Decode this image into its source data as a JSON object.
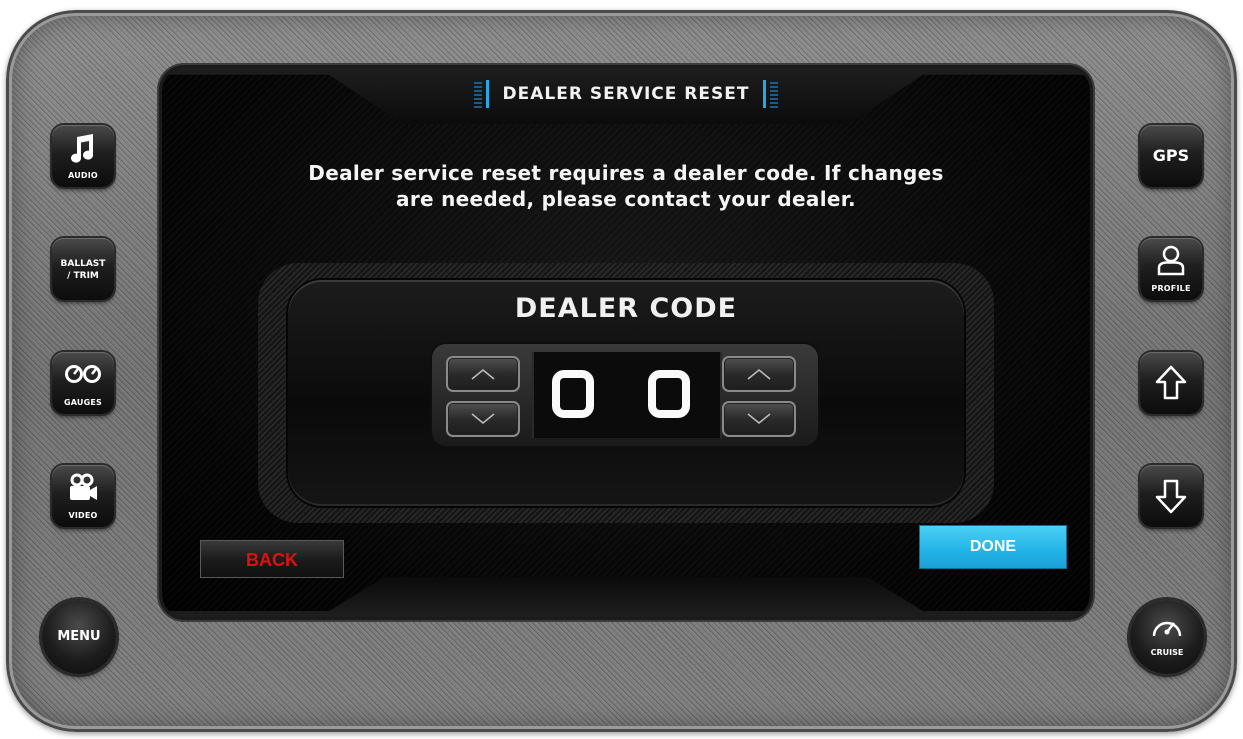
{
  "screen": {
    "title": "DEALER SERVICE RESET",
    "message_line1": "Dealer service reset requires a dealer code. If changes",
    "message_line2": "are needed, please contact your dealer."
  },
  "dealer_code": {
    "label": "DEALER CODE",
    "digit1": "0",
    "digit2": "0"
  },
  "buttons": {
    "back": "BACK",
    "done": "DONE"
  },
  "left_panel": {
    "audio": "AUDIO",
    "ballast_line1": "BALLAST",
    "ballast_line2": "/ TRIM",
    "gauges": "GAUGES",
    "video": "VIDEO",
    "menu": "MENU"
  },
  "right_panel": {
    "gps": "GPS",
    "profile": "PROFILE",
    "cruise": "CRUISE"
  },
  "icons": {
    "audio": "music-note-icon",
    "gauges": "gauges-icon",
    "video": "video-camera-icon",
    "profile": "profile-icon",
    "up": "arrow-up-icon",
    "down": "arrow-down-icon",
    "cruise": "speedometer-icon"
  },
  "colors": {
    "accent_blue": "#22b3e6",
    "back_red": "#e01010",
    "title_bar_accent": "#22a9e8"
  }
}
